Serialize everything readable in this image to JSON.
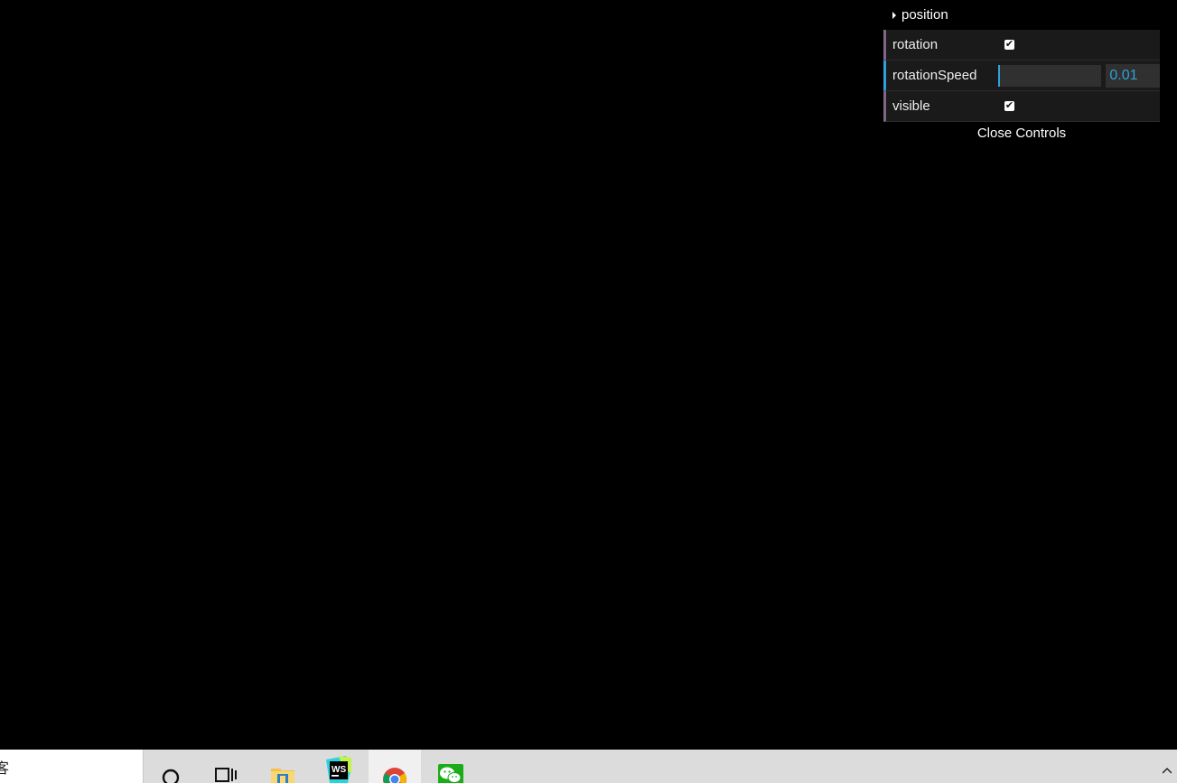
{
  "gui": {
    "folder": {
      "label": "position",
      "expanded": false
    },
    "controls": [
      {
        "label": "rotation",
        "type": "boolean",
        "checked": true
      },
      {
        "label": "rotationSpeed",
        "type": "number",
        "value": "0.01",
        "fraction": 0.01
      },
      {
        "label": "visible",
        "type": "boolean",
        "checked": true
      }
    ],
    "close_label": "Close Controls",
    "tick_glyph": "✔"
  },
  "taskbar": {
    "search_text": "客",
    "items": [
      {
        "name": "cortana-icon"
      },
      {
        "name": "task-view-icon"
      },
      {
        "name": "file-explorer-icon"
      },
      {
        "name": "webstorm-icon",
        "text": "WS"
      },
      {
        "name": "chrome-icon",
        "active": true
      },
      {
        "name": "wechat-icon"
      }
    ]
  },
  "colors": {
    "background": "#000000",
    "bool_accent": "#806787",
    "number_accent": "#2fa1d6",
    "row_bg": "#1a1a1a"
  }
}
